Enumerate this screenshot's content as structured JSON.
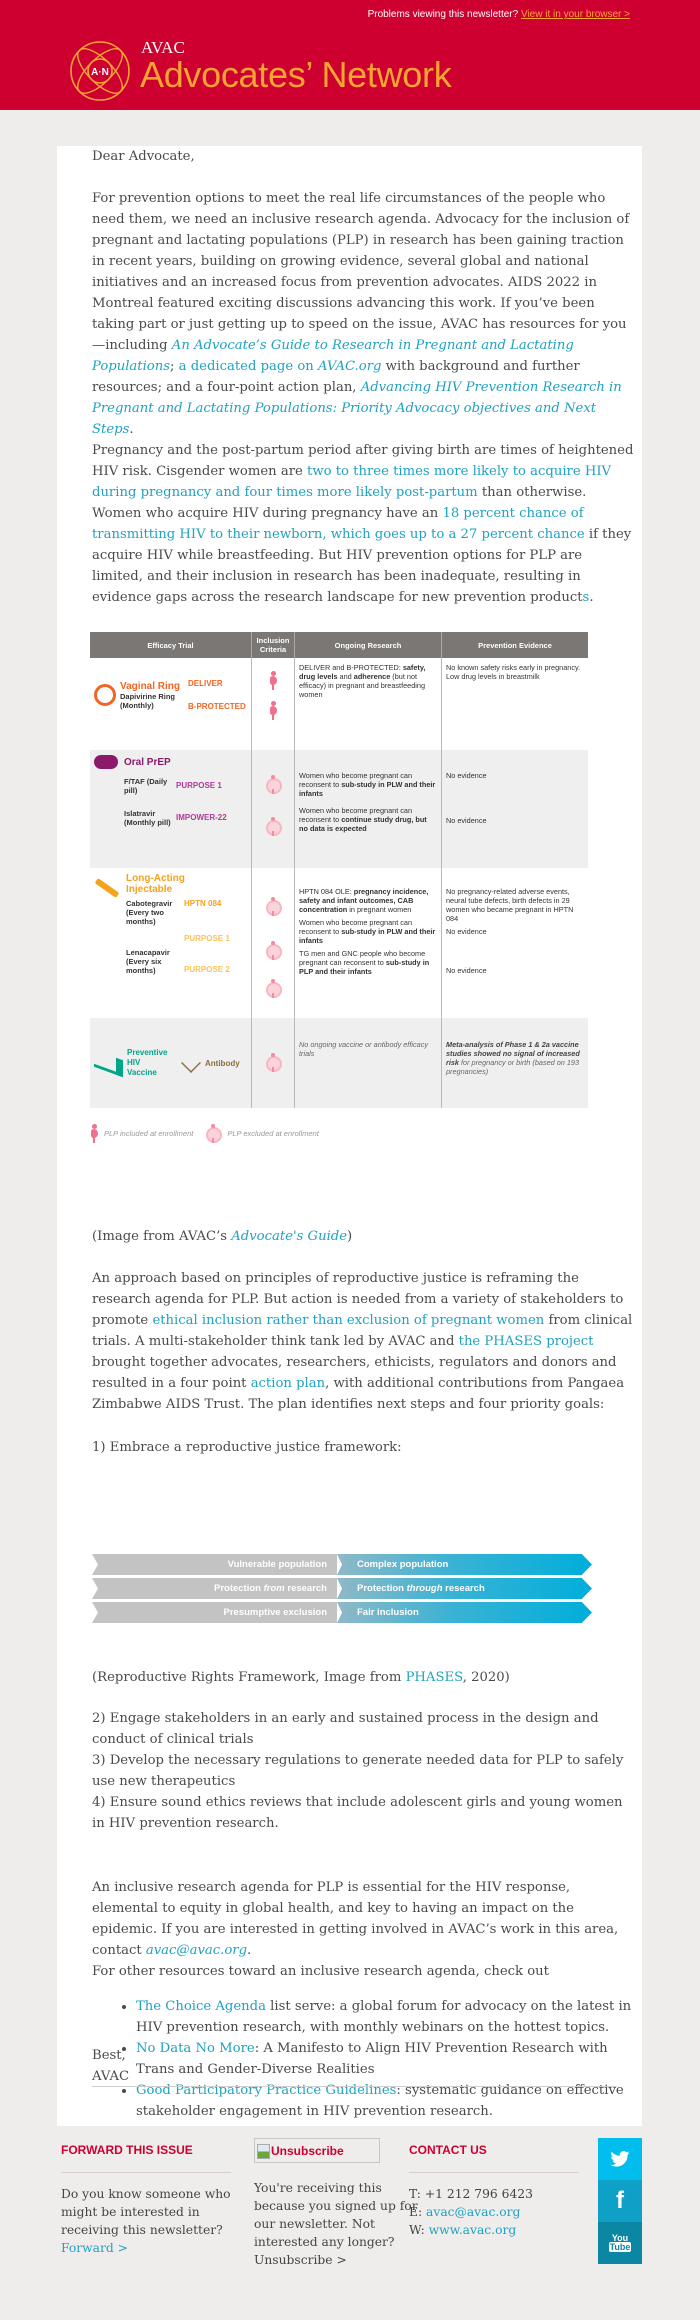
{
  "header": {
    "problems_text": "Problems viewing this newsletter?",
    "view_link": "View it in your browser >",
    "logo_monogram": "A·N",
    "brand_small": "AVAC",
    "brand_big": "Advocates’ Network"
  },
  "body": {
    "greeting": "Dear Advocate,",
    "p1": {
      "t1": "For prevention options to meet the real life circumstances of the people who need them, we need an inclusive research agenda. Advocacy for the inclusion of pregnant and lactating populations (PLP) in research has been gaining traction in recent years, building on growing evidence, several global and national initiatives and an increased focus from prevention advocates. AIDS 2022 in Montreal featured exciting discussions advancing this work. If you’ve been taking part or just getting up to speed on the issue, AVAC has resources for you—including ",
      "link1": "An Advocate’s Guide to Research in Pregnant and Lactating Populations",
      "t2": "; ",
      "link2": "a dedicated page on ",
      "link2b": "AVAC.org",
      "t3": " with background and further resources; and a four-point action plan, ",
      "link3": "Advancing HIV Prevention Research in Pregnant and Lactating Populations: Priority Advocacy objectives and Next Steps",
      "t4": "."
    },
    "p2": {
      "t1": "Pregnancy and the post-partum period after giving birth are times of heightened HIV risk. Cisgender women are ",
      "link1": "two to three times more likely to acquire HIV during pregnancy and four times more likely post-partum",
      "t2": " than otherwise. Women who acquire HIV during pregnancy have an ",
      "link2": "18 percent chance of transmitting HIV to their newborn, which goes up to a 27 percent chance",
      "t3": " if they acquire HIV while breastfeeding. But HIV prevention options for PLP are limited, and their inclusion in research has been inadequate, resulting in evidence gaps across the research landscape for new prevention product",
      "link3": "s",
      "t4": "."
    },
    "caption1": {
      "t1": "(Image from AVAC’s ",
      "link": "Advocate's Guide",
      "t2": ")"
    },
    "p3": {
      "t1": "An approach based on principles of reproductive justice is reframing the research agenda for PLP. But action is needed from a variety of stakeholders to promote ",
      "link1": "ethical inclusion rather than exclusion of pregnant women",
      "t2": " from clinical trials. A multi-stakeholder think tank led by AVAC and ",
      "link2": "the PHASES project",
      "t3": " brought together advocates, researchers, ethicists, regulators and donors and resulted in a four point ",
      "link3": "action plan",
      "t4": ", with additional contributions from Pangaea Zimbabwe AIDS Trust. The plan identifies next steps and four priority goals:"
    },
    "goal1": "1) Embrace a reproductive justice framework:",
    "caption2": {
      "t1": "(Reproductive Rights Framework, Image from ",
      "link": "PHASES",
      "t2": ", 2020)"
    },
    "goals": [
      "2) Engage stakeholders in an early and sustained process in the design and conduct of clinical trials",
      "3) Develop the necessary regulations to generate needed data for PLP to safely use new therapeutics",
      "4) Ensure sound ethics reviews that include adolescent girls and young women in HIV prevention research."
    ],
    "p4": {
      "t1": "An inclusive research agenda for PLP is essential for the HIV response, elemental to equity in global health, and key to having an impact on the epidemic. If you are interested in getting involved in AVAC’s work in this area, contact ",
      "link": "avac@avac.org",
      "t2": "."
    },
    "resources_intro": "For other resources toward an inclusive research agenda, check out",
    "resources": [
      {
        "link": "The Choice Agenda",
        "text": " list serve: a global forum for advocacy on the latest in HIV prevention research, with monthly webinars on the hottest topics."
      },
      {
        "link": "No Data No More",
        "text": ": A Manifesto to Align HIV Prevention Research with Trans and Gender-Diverse Realities"
      },
      {
        "link": "Good Participatory Practice Guidelines",
        "text": ": systematic guidance on effective stakeholder engagement in HIV prevention research."
      }
    ],
    "signoff": "Best,",
    "signature": "AVAC"
  },
  "trial_table": {
    "headers": [
      "Efficacy Trial",
      "Inclusion Criteria",
      "Ongoing Research",
      "Prevention Evidence"
    ],
    "groups": [
      {
        "product": "Vaginal Ring",
        "color": "#f26522",
        "icon": "ring-icon",
        "sub": "Dapivirine Ring (Monthly)",
        "trials": [
          {
            "name": "DELIVER",
            "criteria": "included"
          },
          {
            "name": "B-PROTECTED",
            "criteria": "included"
          }
        ],
        "research": [
          {
            "pre": "DELIVER and B-PROTECTED: ",
            "bold": "safety, drug levels",
            "mid": " and ",
            "bold2": "adherence",
            "post": " (but not efficacy) in pregnant and breastfeeding women"
          }
        ],
        "evidence": [
          "No known safety risks early in pregnancy. Low drug levels in breastmilk"
        ]
      },
      {
        "product": "Oral PrEP",
        "color": "#8b1a6b",
        "icon": "pills-icon",
        "rows": [
          {
            "sub": "F/TAF (Daily pill)",
            "trial": "PURPOSE 1",
            "criteria": "excluded",
            "research": {
              "pre": "Women who become pregnant can reconsent to ",
              "bold": "sub-study in PLW and their infants"
            },
            "evidence": "No evidence"
          },
          {
            "sub": "Islatravir (Monthly pill)",
            "trial": "IMPOWER-22",
            "criteria": "excluded",
            "research": {
              "pre": "Women who become pregnant can reconsent to ",
              "bold": "continue study drug, but no data is expected"
            },
            "evidence": "No evidence"
          }
        ],
        "trial_color": "#b03a96"
      },
      {
        "product": "Long-Acting Injectable",
        "color": "#f7a21b",
        "icon": "syringe-icon",
        "rows": [
          {
            "sub": "Cabotegravir (Every two months)",
            "trial": "HPTN 084",
            "criteria": "excluded",
            "research": {
              "pre": "HPTN 084 OLE: ",
              "bold": "pregnancy incidence, safety and infant outcomes, CAB concentration",
              "post": " in pregnant women"
            },
            "evidence": "No pregnancy-related adverse events, neural tube defects, birth defects in 29 women who became pregnant in HPTN 084"
          },
          {
            "sub": "Lenacapavir (Every six months)",
            "trial": "PURPOSE 1",
            "criteria": "excluded",
            "research": {
              "pre": "Women who become pregnant can reconsent to ",
              "bold": "sub-study in PLW and their infants"
            },
            "evidence": "No evidence"
          },
          {
            "sub": "",
            "trial": "PURPOSE 2",
            "criteria": "excluded",
            "research": {
              "pre": "TG men and GNC people who become pregnant can reconsent to ",
              "bold": "sub-study in PLP and their infants"
            },
            "evidence": "No evidence"
          }
        ],
        "trial_color": "#fbc25a"
      },
      {
        "product": "Preventive HIV Vaccine",
        "color": "#00a58a",
        "icon": "vaccine-icon",
        "product2": "Antibody",
        "color2": "#8a6d3b",
        "criteria": "excluded",
        "research": "No ongoing vaccine or antibody efficacy trials",
        "evidence": {
          "bold": "Meta-analysis of Phase 1 & 2a vaccine studies showed no signal of increased risk",
          "post": " for pregnancy or birth (based on 193 pregnancies)"
        }
      }
    ],
    "legend": [
      "PLP included at enrollment",
      "PLP excluded at enrollment"
    ]
  },
  "framework": {
    "rows": [
      {
        "from": "Vulnerable population",
        "to": "Complex population"
      },
      {
        "from_pre": "Protection ",
        "from_it": "from",
        "from_post": " research",
        "to_pre": "Protection ",
        "to_it": "through",
        "to_post": " research"
      },
      {
        "from": "Presumptive exclusion",
        "to": "Fair inclusion"
      }
    ]
  },
  "footer": {
    "forward": {
      "heading": "FORWARD THIS ISSUE",
      "text": "Do you know someone who might be interested in receiving this newsletter?",
      "link": "Forward >"
    },
    "unsubscribe": {
      "image_alt": "Unsubscribe",
      "text": "You're receiving this because you signed up for our newsletter. Not interested any longer?",
      "link": "Unsubscribe >"
    },
    "contact": {
      "heading": "CONTACT US",
      "phone_label": "T:",
      "phone": "+1 212 796 6423",
      "email_label": "E:",
      "email": "avac@avac.org",
      "web_label": "W:",
      "web": "www.avac.org"
    },
    "social": [
      {
        "name": "twitter",
        "color": "#00bdee"
      },
      {
        "name": "facebook",
        "color": "#0ea0c7"
      },
      {
        "name": "youtube",
        "color": "#0b87a3",
        "label1": "You",
        "label2": "Tube"
      }
    ]
  }
}
